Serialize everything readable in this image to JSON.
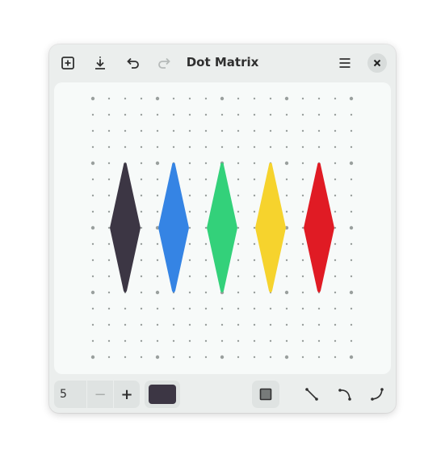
{
  "window": {
    "title": "Dot Matrix"
  },
  "headerbar": {
    "left_icons": [
      "new-canvas-icon",
      "export-icon",
      "undo-icon",
      "redo-icon"
    ],
    "right_icons": [
      "menu-icon",
      "close-icon"
    ],
    "redo_enabled": false
  },
  "canvas": {
    "grid_columns": 17,
    "grid_rows": 17,
    "major_every": 4,
    "dot_color": "#9aa09e",
    "shapes": [
      {
        "name": "diamond-dark",
        "color": "#3c3644"
      },
      {
        "name": "diamond-blue",
        "color": "#3584e4"
      },
      {
        "name": "diamond-green",
        "color": "#33d17a"
      },
      {
        "name": "diamond-yellow",
        "color": "#f6d32d"
      },
      {
        "name": "diamond-red",
        "color": "#e01b24"
      }
    ]
  },
  "toolbar": {
    "stroke_width_value": "5",
    "minus_label": "−",
    "plus_label": "+",
    "current_color": "#3c3644",
    "tools": [
      "square-shape-icon",
      "straight-line-icon",
      "curve-down-icon",
      "curve-up-icon"
    ],
    "active_tool": "square-shape-icon"
  }
}
